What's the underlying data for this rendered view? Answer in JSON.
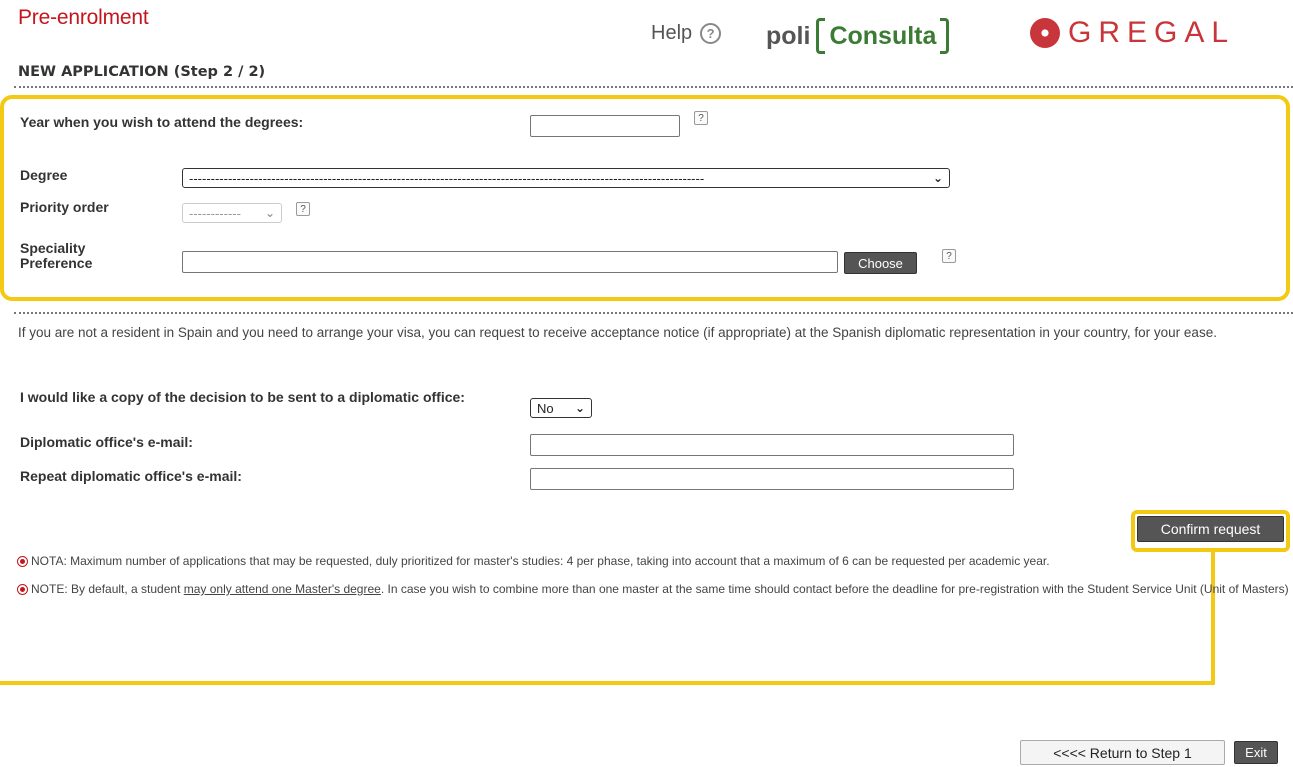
{
  "header": {
    "title": "Pre-enrolment",
    "subtitle": "NEW APPLICATION (Step 2 / 2)",
    "help_label": "Help",
    "logo_poli": "poli",
    "logo_consulta": "Consulta",
    "logo_gregal": "GREGAL"
  },
  "form": {
    "year_label": "Year when you wish to attend the degrees:",
    "year_value": "",
    "degree_label": "Degree",
    "degree_selected": "-----------------------------------------------------------------------------------------------------------------------",
    "priority_label": "Priority order",
    "priority_selected": "------------",
    "speciality_label_1": "Speciality",
    "speciality_label_2": "Preference",
    "speciality_value": "",
    "choose_button": "Choose",
    "help_glyph": "?"
  },
  "visa": {
    "info": "If you are not a resident in Spain and you need to arrange your visa, you can request to receive acceptance notice (if appropriate) at the Spanish diplomatic representation in your country, for your ease.",
    "copy_label": "I would like a copy of the decision to be sent to a diplomatic office:",
    "copy_selected": "No",
    "email_label": "Diplomatic office's e-mail:",
    "email_value": "",
    "repeat_email_label": "Repeat diplomatic office's e-mail:",
    "repeat_email_value": ""
  },
  "actions": {
    "confirm_button": "Confirm request",
    "return_button": "<<<< Return to Step 1",
    "exit_button": "Exit"
  },
  "notes": {
    "note1": "NOTA: Maximum number of applications that may be requested, duly prioritized for master's studies: 4 per phase, taking into account that a maximum of 6 can be requested per academic year.",
    "note2_prefix": "NOTE: By default, a student ",
    "note2_link": "may only attend one Master's degree",
    "note2_suffix": ". In case you wish to combine more than one master at the same time should contact before the deadline for pre-registration with the Student Service Unit (Unit of Masters)"
  },
  "colors": {
    "brand_red": "#c4161c",
    "highlight_yellow": "#f4c913",
    "consulta_green": "#3b7b33"
  }
}
